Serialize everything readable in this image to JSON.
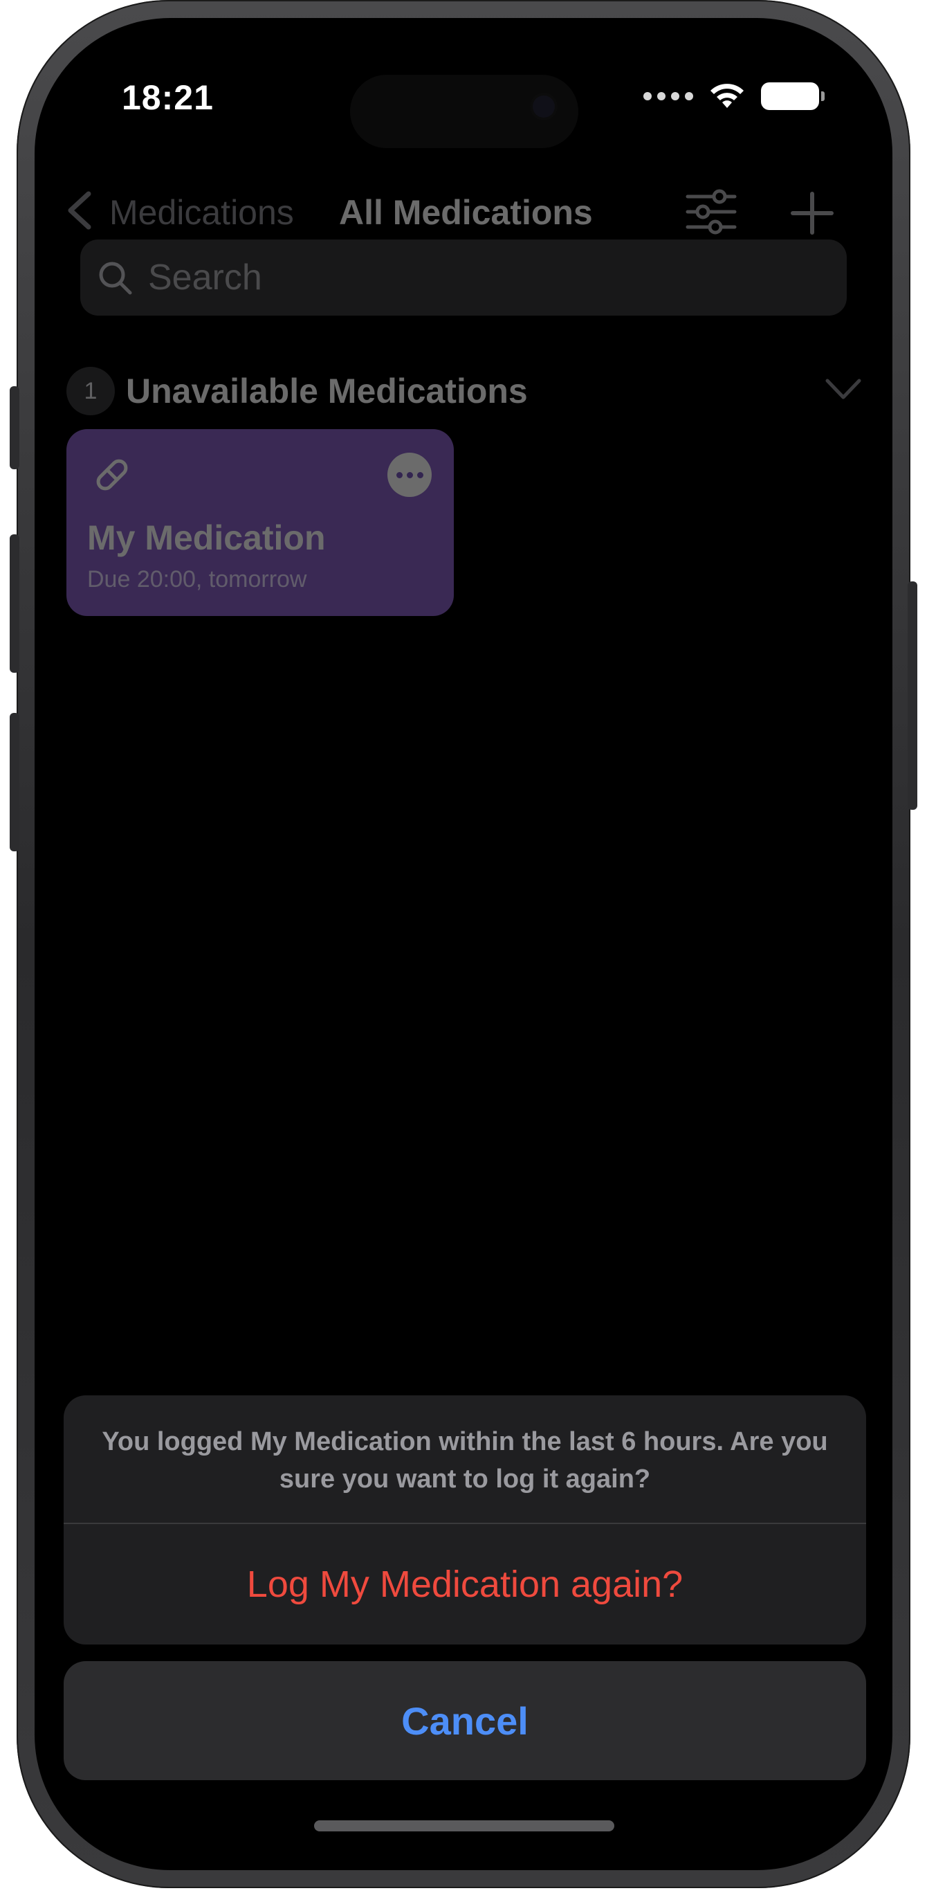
{
  "status_bar": {
    "time": "18:21"
  },
  "nav": {
    "back_label": "Medications",
    "title": "All Medications"
  },
  "search": {
    "placeholder": "Search"
  },
  "section": {
    "count": "1",
    "title": "Unavailable Medications"
  },
  "medication_card": {
    "name": "My Medication",
    "due": "Due 20:00, tomorrow",
    "color": "#8a63c9"
  },
  "action_sheet": {
    "message": "You logged My Medication within the last 6 hours. Are you sure you want to log it again?",
    "action_label": "Log My Medication again?",
    "cancel_label": "Cancel"
  },
  "colors": {
    "destructive": "#ef4a3e",
    "accent": "#4d8ef7",
    "background": "#000000"
  },
  "icons": [
    "back-chevron-icon",
    "filter-sliders-icon",
    "plus-icon",
    "search-icon",
    "chevron-down-icon",
    "pill-icon",
    "more-icon",
    "wifi-icon",
    "battery-icon"
  ]
}
